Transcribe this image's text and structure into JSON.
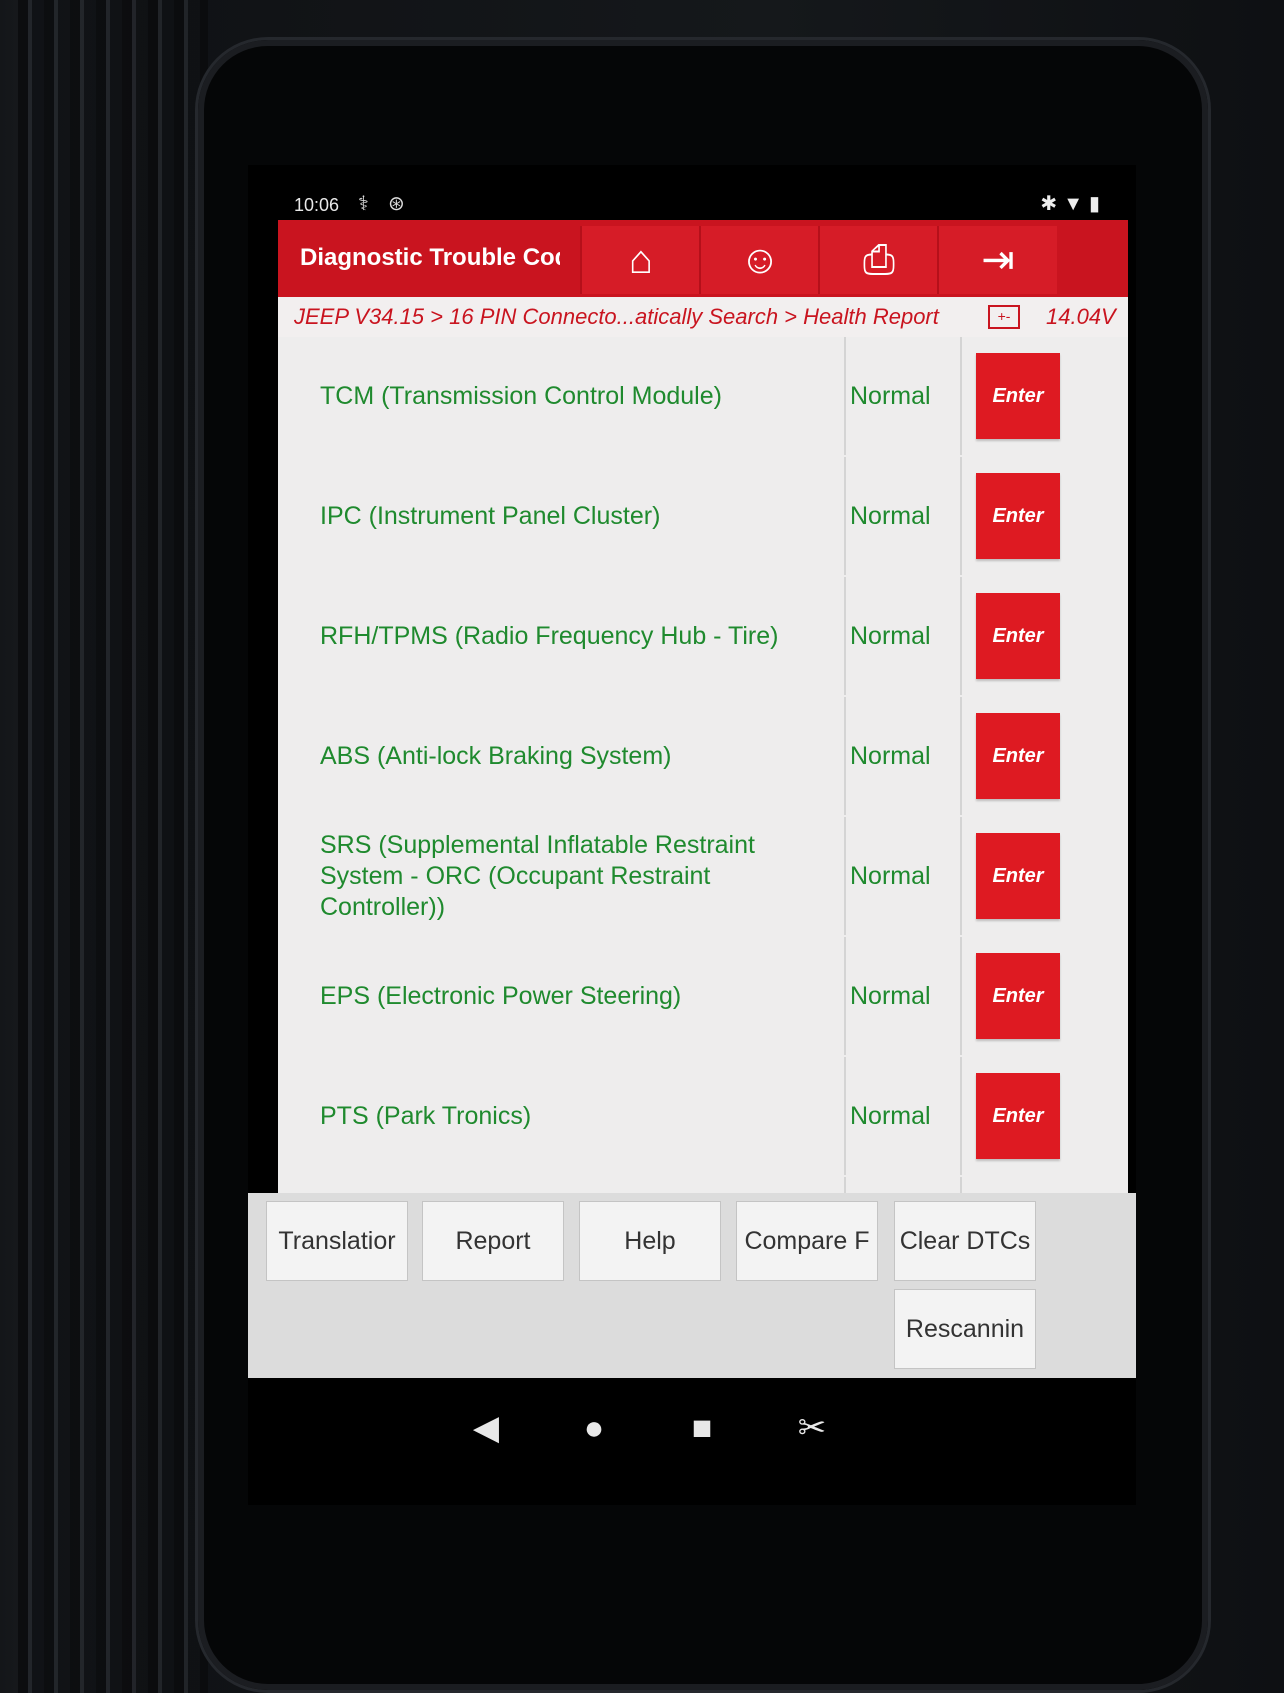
{
  "status_bar": {
    "time": "10:06",
    "icons_left": [
      "stethoscope-icon",
      "bluetooth-service-icon"
    ],
    "icons_right": [
      "bluetooth-icon",
      "wifi-icon",
      "battery-icon"
    ]
  },
  "header": {
    "title": "Diagnostic Trouble Cod",
    "accent_color": "#c9141f",
    "buttons": [
      {
        "name": "home-icon",
        "glyph": "⌂"
      },
      {
        "name": "user-support-icon",
        "glyph": "☺"
      },
      {
        "name": "print-icon",
        "glyph": "⎙"
      },
      {
        "name": "exit-icon",
        "glyph": "⇥"
      }
    ]
  },
  "breadcrumb": {
    "path": "JEEP V34.15 > 16 PIN Connecto...atically Search > Health Report",
    "voltage": "14.04V"
  },
  "modules": [
    {
      "name": "TCM (Transmission Control Module)",
      "status": "Normal",
      "action": "Enter"
    },
    {
      "name": "IPC (Instrument Panel Cluster)",
      "status": "Normal",
      "action": "Enter"
    },
    {
      "name": "RFH/TPMS (Radio Frequency Hub - Tire)",
      "status": "Normal",
      "action": "Enter"
    },
    {
      "name": "ABS (Anti-lock Braking System)",
      "status": "Normal",
      "action": "Enter"
    },
    {
      "name": "SRS (Supplemental Inflatable Restraint System - ORC (Occupant Restraint Controller))",
      "status": "Normal",
      "action": "Enter"
    },
    {
      "name": "EPS (Electronic Power Steering)",
      "status": "Normal",
      "action": "Enter"
    },
    {
      "name": "PTS (Park Tronics)",
      "status": "Normal",
      "action": "Enter"
    }
  ],
  "footer_buttons": {
    "translation": "Translatior",
    "report": "Report",
    "help": "Help",
    "compare": "Compare F",
    "clear_dtcs": "Clear DTCs",
    "rescanning": "Rescannin"
  },
  "nav_bar": {
    "back": "◀",
    "home": "●",
    "recents": "■",
    "screenshot": "✂"
  }
}
